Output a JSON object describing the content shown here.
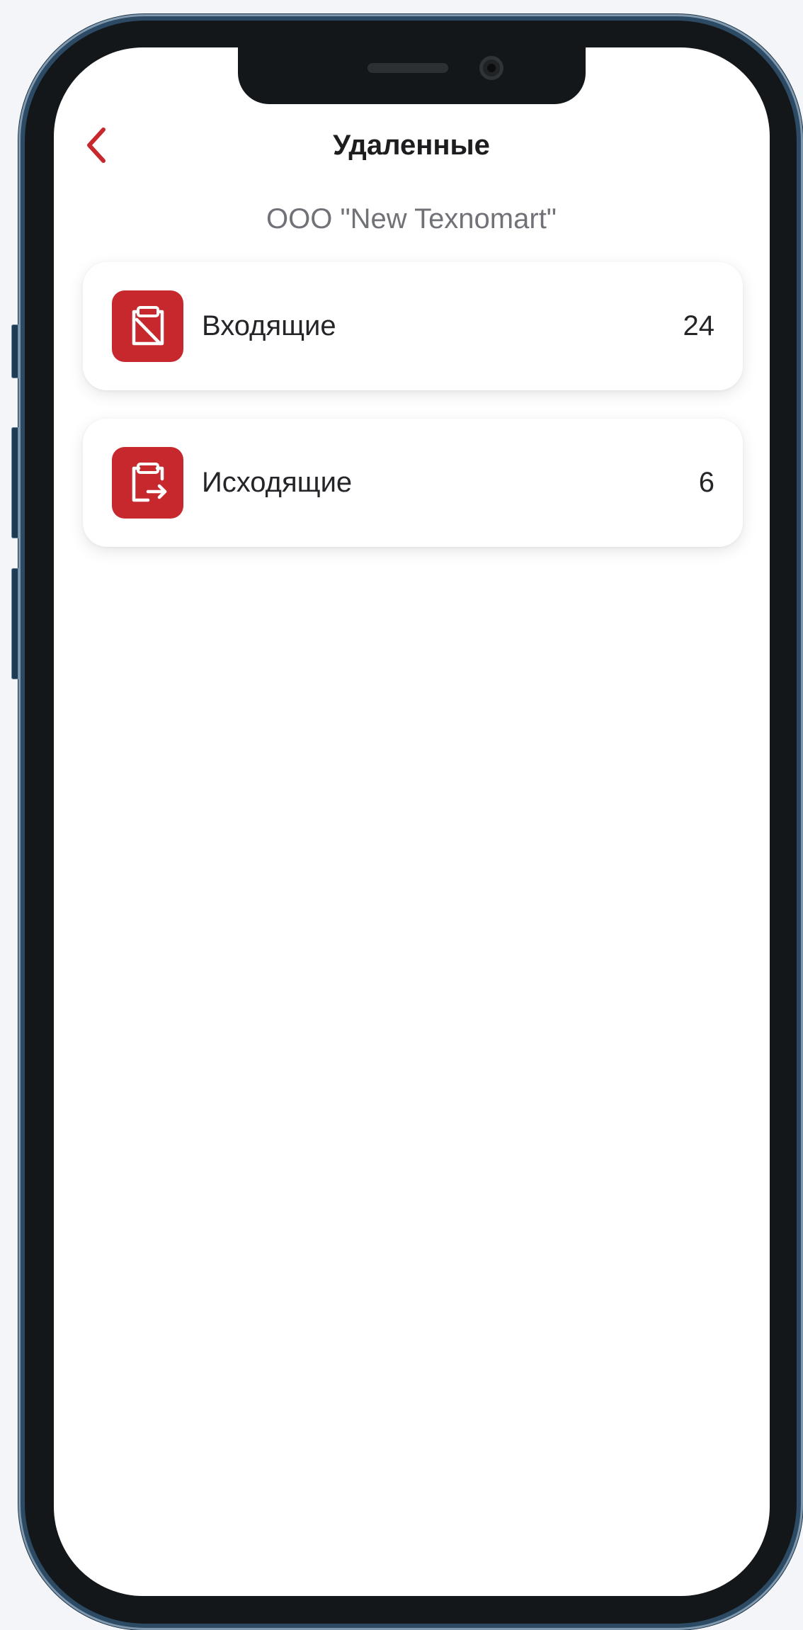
{
  "header": {
    "title": "Удаленные",
    "back_icon": "chevron-left-icon"
  },
  "company": {
    "name": "ООО \"New Texnomart\""
  },
  "folders": [
    {
      "label": "Входящие",
      "count": "24",
      "icon": "clipboard-off-icon"
    },
    {
      "label": "Исходящие",
      "count": "6",
      "icon": "clipboard-export-icon"
    }
  ],
  "colors": {
    "accent": "#c7282d",
    "title_text": "#1d1d1f",
    "secondary_text": "#707277",
    "card_background": "#ffffff",
    "frame": "#2d4a64",
    "page_background": "#f3f5f8"
  }
}
